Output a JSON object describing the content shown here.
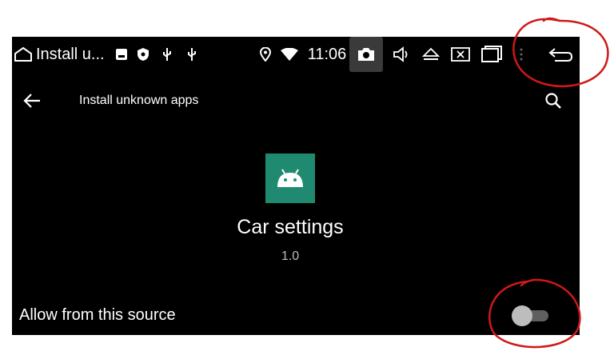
{
  "status_bar": {
    "title": "Install u...",
    "time": "11:06",
    "icons": [
      "home-icon",
      "gallery-notification-icon",
      "shield-icon",
      "usb-icon",
      "usb-icon",
      "location-icon",
      "wifi-icon",
      "camera-icon",
      "volume-icon",
      "eject-icon",
      "close-window-icon",
      "recent-apps-icon",
      "more-icon",
      "back-icon"
    ]
  },
  "app_bar": {
    "title": "Install unknown apps",
    "back_icon": "back-arrow-icon",
    "search_icon": "search-icon"
  },
  "app_info": {
    "name": "Car settings",
    "version": "1.0",
    "icon": "android-icon",
    "icon_color": "#1f8a70"
  },
  "allow_source": {
    "label": "Allow from this source",
    "enabled": false
  },
  "colors": {
    "background": "#000000",
    "annotation": "#d01818"
  }
}
